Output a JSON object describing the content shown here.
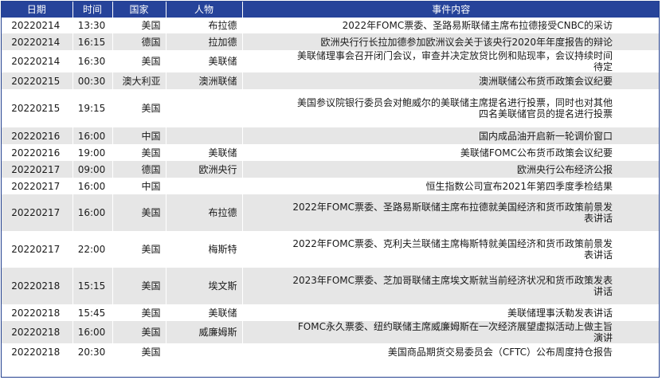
{
  "table": {
    "headers": [
      "日期",
      "时间",
      "国家",
      "人物",
      "事件内容"
    ],
    "rows": [
      {
        "date": "20220214",
        "time": "13:30",
        "country": "美国",
        "person": "布拉德",
        "event": "2022年FOMC票委、圣路易斯联储主席布拉德接受CNBC的采访"
      },
      {
        "date": "20220214",
        "time": "16:15",
        "country": "德国",
        "person": "拉加德",
        "event": "欧洲央行行长拉加德参加欧洲议会关于该央行2020年年度报告的辩论"
      },
      {
        "date": "20220214",
        "time": "16:30",
        "country": "美国",
        "person": "美联储",
        "event": "美联储理事会召开闭门会议，审查并决定放贷比例和贴现率，会议持续时间待定"
      },
      {
        "date": "20220215",
        "time": "00:30",
        "country": "澳大利亚",
        "person": "澳洲联储",
        "event": "澳洲联储公布货币政策会议纪要"
      },
      {
        "date": "20220215",
        "time": "19:15",
        "country": "美国",
        "person": "",
        "event": "美国参议院银行委员会对鲍威尔的美联储主席提名进行投票，同时也对其他四名美联储官员的提名进行投票"
      },
      {
        "date": "20220216",
        "time": "16:00",
        "country": "中国",
        "person": "",
        "event": "国内成品油开启新一轮调价窗口"
      },
      {
        "date": "20220216",
        "time": "19:00",
        "country": "美国",
        "person": "美联储",
        "event": "美联储FOMC公布货币政策会议纪要"
      },
      {
        "date": "20220217",
        "time": "09:00",
        "country": "德国",
        "person": "欧洲央行",
        "event": "欧洲央行公布经济公报"
      },
      {
        "date": "20220217",
        "time": "16:00",
        "country": "中国",
        "person": "",
        "event": "恒生指数公司宣布2021年第四季度季检结果"
      },
      {
        "date": "20220217",
        "time": "16:00",
        "country": "美国",
        "person": "布拉德",
        "event": "2022年FOMC票委、圣路易斯联储主席布拉德就美国经济和货币政策前景发表讲话"
      },
      {
        "date": "20220217",
        "time": "22:00",
        "country": "美国",
        "person": "梅斯特",
        "event": "2022年FOMC票委、克利夫兰联储主席梅斯特就美国经济和货币政策前景发表讲话"
      },
      {
        "date": "20220218",
        "time": "15:15",
        "country": "美国",
        "person": "埃文斯",
        "event": "2023年FOMC票委、芝加哥联储主席埃文斯就当前经济状况和货币政策发表讲话"
      },
      {
        "date": "20220218",
        "time": "15:45",
        "country": "美国",
        "person": "美联储",
        "event": "美联储理事沃勒发表讲话"
      },
      {
        "date": "20220218",
        "time": "16:00",
        "country": "美国",
        "person": "威廉姆斯",
        "event": "FOMC永久票委、纽约联储主席威廉姆斯在一次经济展望虚拟活动上做主旨演讲"
      },
      {
        "date": "20220218",
        "time": "20:30",
        "country": "美国",
        "person": "",
        "event": "美国商品期货交易委员会（CFTC）公布周度持仓报告"
      }
    ]
  }
}
